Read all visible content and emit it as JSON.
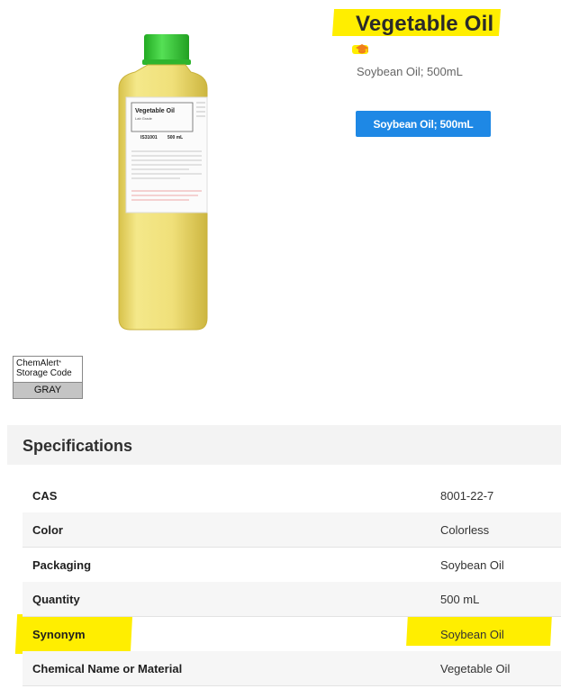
{
  "product": {
    "title": "Vegetable Oil",
    "subtitle": "Soybean Oil; 500mL",
    "variant_button": "Soybean Oil; 500mL",
    "label_title": "Vegetable Oil",
    "label_grade": "Lab Grade",
    "label_sku": "IS31001",
    "label_volume": "500 mL"
  },
  "chemalert": {
    "line1": "ChemAlert",
    "mark": "*",
    "line2": "Storage Code",
    "code": "GRAY"
  },
  "specs": {
    "title": "Specifications",
    "rows": [
      {
        "key": "CAS",
        "value": "8001-22-7"
      },
      {
        "key": "Color",
        "value": "Colorless"
      },
      {
        "key": "Packaging",
        "value": "Soybean Oil"
      },
      {
        "key": "Quantity",
        "value": "500 mL"
      },
      {
        "key": "Synonym",
        "value": "Soybean Oil"
      },
      {
        "key": "Chemical Name or Material",
        "value": "Vegetable Oil"
      }
    ]
  },
  "colors": {
    "highlight": "#ffee00",
    "button": "#1e88e5",
    "cap": "#33cc33",
    "oil": "#f2e37a",
    "education_icon": "#f07e1b"
  },
  "icons": {
    "education": "graduation-cap-icon"
  }
}
